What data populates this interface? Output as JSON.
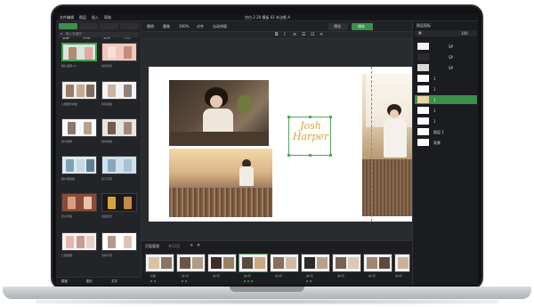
{
  "app": {
    "menu": [
      "文件编辑",
      "图层",
      "插入",
      "帮助"
    ],
    "title": "空白 2 20 模板 01 外边框 A"
  },
  "left_panel": {
    "tabs": [
      "全部",
      "横幅",
      "竖版",
      "方形"
    ],
    "search_placeholder": "输入关键词",
    "captions": [
      "婚礼画册-01",
      "成长纪念",
      "儿童摄影模板",
      "写真模板",
      "旅行相册",
      "简约排版",
      "婚纱照模板",
      "亲子写真",
      "复古风格",
      "校园纪念",
      "儿童画册",
      "清新写真"
    ],
    "footer": [
      "模板",
      "图片",
      "文字"
    ]
  },
  "toolbar": {
    "zoom": "100%",
    "labels": [
      "撤销",
      "重做",
      "对齐",
      "自动排版"
    ],
    "preview_button": "预览",
    "save_button": "保存"
  },
  "spread": {
    "title_text": "Josh Harper"
  },
  "filmstrip": {
    "header": "页面管理",
    "page_count_label": "共12页",
    "captions": [
      "封面",
      "第1页",
      "第2页",
      "第3页",
      "第4页",
      "第5页",
      "第6页",
      "第7页",
      "第8页",
      "封底"
    ]
  },
  "right_panel": {
    "title": "图层面板",
    "zoom_value": "100",
    "layers": [
      "SP",
      "SP",
      "SP",
      "1",
      "1",
      "1",
      "1",
      "1",
      "图层 1",
      "背景"
    ],
    "selected_index": 5
  },
  "colors": {
    "accent": "#3a8f4c",
    "gold": "#d4a63a",
    "dark_bg": "#1f2023"
  }
}
